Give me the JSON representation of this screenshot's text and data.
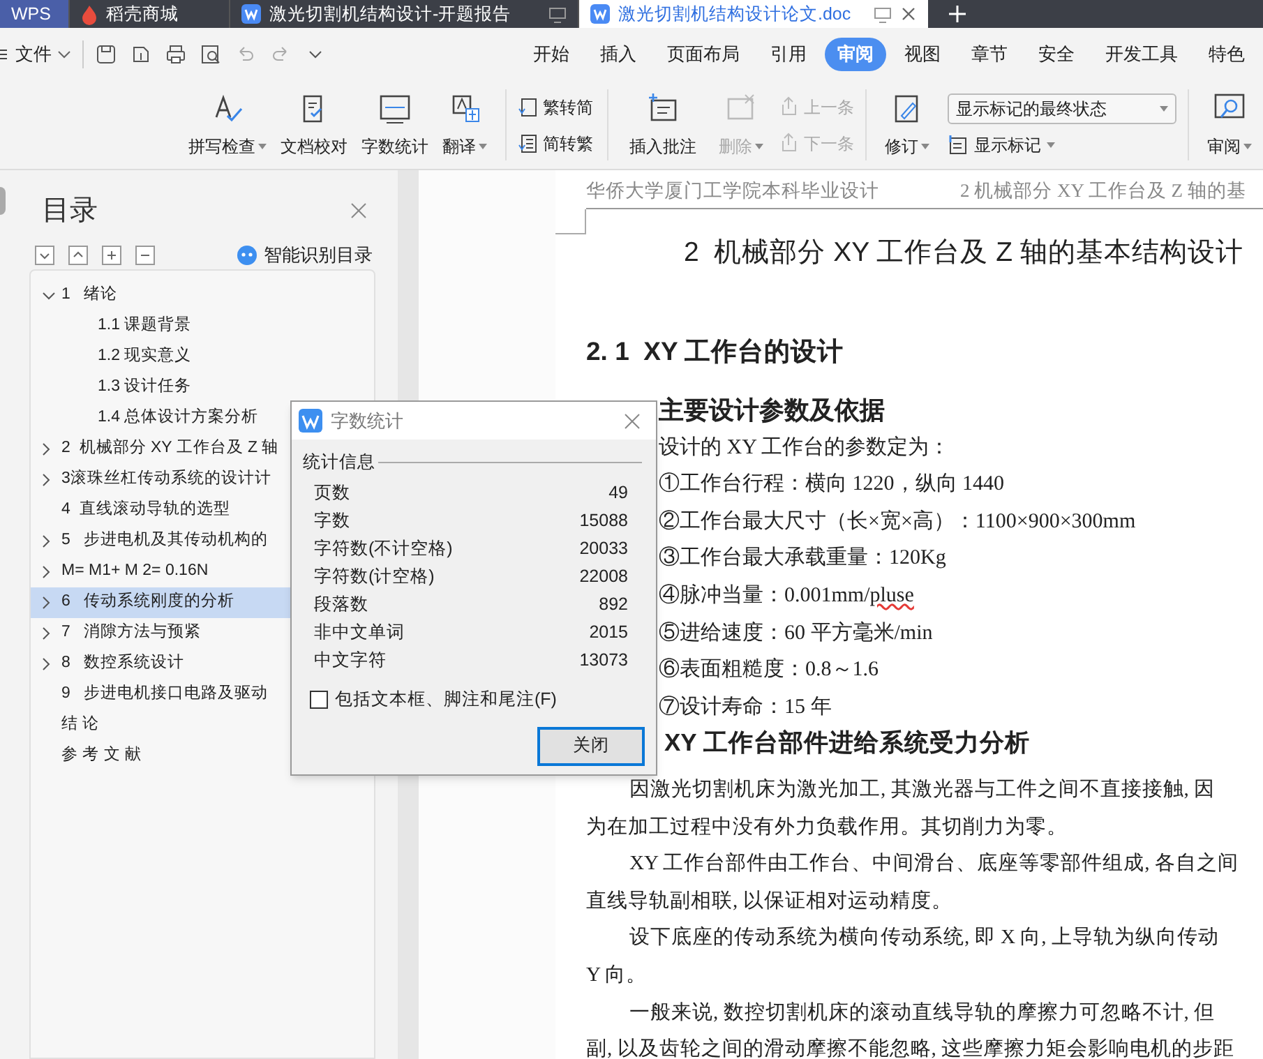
{
  "tabs": [
    {
      "label": "WPS",
      "kind": "home",
      "selected": false
    },
    {
      "label": "稻壳商城",
      "kind": "store",
      "selected": false
    },
    {
      "label": "激光切割机结构设计-开题报告",
      "kind": "doc",
      "selected": false
    },
    {
      "label": "激光切割机结构设计论文.doc",
      "kind": "doc",
      "selected": true
    }
  ],
  "menu": {
    "file": "文件",
    "ribbon_tabs": [
      {
        "label": "开始",
        "selected": false
      },
      {
        "label": "插入",
        "selected": false
      },
      {
        "label": "页面布局",
        "selected": false
      },
      {
        "label": "引用",
        "selected": false
      },
      {
        "label": "审阅",
        "selected": true
      },
      {
        "label": "视图",
        "selected": false
      },
      {
        "label": "章节",
        "selected": false
      },
      {
        "label": "安全",
        "selected": false
      },
      {
        "label": "开发工具",
        "selected": false
      },
      {
        "label": "特色",
        "selected": false
      }
    ]
  },
  "ribbon": {
    "proofing": [
      {
        "label": "拼写检查",
        "kind": "spell",
        "dropdown": true
      },
      {
        "label": "文档校对",
        "kind": "check",
        "dropdown": false
      },
      {
        "label": "字数统计",
        "kind": "count",
        "dropdown": false
      },
      {
        "label": "翻译",
        "kind": "translate",
        "dropdown": true
      }
    ],
    "convert": [
      {
        "label": "繁转简",
        "kind": "trad"
      },
      {
        "label": "简转繁",
        "kind": "simp"
      }
    ],
    "comment": {
      "label": "插入批注"
    },
    "comment_nav": [
      {
        "label": "删除",
        "dropdown": true,
        "disabled": true
      },
      {
        "label": "上一条",
        "dropdown": false,
        "disabled": true
      },
      {
        "label": "下一条",
        "dropdown": false,
        "disabled": true
      }
    ],
    "track": {
      "label": "修订"
    },
    "display_select": {
      "value": "显示标记的最终状态"
    },
    "show_markup": {
      "label": "显示标记"
    },
    "review": {
      "label": "审阅"
    }
  },
  "toc": {
    "title": "目录",
    "smart_label": "智能识别目录",
    "items": [
      {
        "label": "1   绪论",
        "expanded": true,
        "children": [
          {
            "label": "1.1 课题背景"
          },
          {
            "label": "1.2 现实意义"
          },
          {
            "label": "1.3 设计任务"
          },
          {
            "label": "1.4 总体设计方案分析"
          }
        ],
        "selected": false
      },
      {
        "label": "2  机械部分 XY 工作台及 Z 轴",
        "expanded": false,
        "has_children": true,
        "selected": false
      },
      {
        "label": "3滚珠丝杠传动系统的设计计",
        "expanded": false,
        "has_children": true,
        "selected": false
      },
      {
        "label": "4  直线滚动导轨的选型",
        "expanded": false,
        "has_children": false,
        "selected": false
      },
      {
        "label": "5   步进电机及其传动机构的",
        "expanded": false,
        "has_children": true,
        "selected": false
      },
      {
        "label": "M= M1+ M 2= 0.16N",
        "expanded": false,
        "has_children": true,
        "selected": false
      },
      {
        "label": "6   传动系统刚度的分析",
        "expanded": false,
        "has_children": true,
        "selected": true
      },
      {
        "label": "7   消隙方法与预紧",
        "expanded": false,
        "has_children": true,
        "selected": false
      },
      {
        "label": "8   数控系统设计",
        "expanded": false,
        "has_children": true,
        "selected": false
      },
      {
        "label": "9   步进电机接口电路及驱动",
        "expanded": false,
        "has_children": false,
        "selected": false
      },
      {
        "label": "结 论",
        "expanded": false,
        "has_children": false,
        "selected": false
      },
      {
        "label": "参 考 文 献",
        "expanded": false,
        "has_children": false,
        "selected": false
      }
    ]
  },
  "document": {
    "header_left": "华侨大学厦门工学院本科毕业设计",
    "header_right": "2  机械部分 XY 工作台及 Z 轴的基",
    "chapter_title": "2  机械部分 XY 工作台及 Z 轴的基本结构设计",
    "section_title": "2. 1  XY 工作台的设计",
    "subsection_1": "主要设计参数及依据",
    "params": [
      {
        "parts": [
          {
            "text": "设计的 XY 工作台的参数定为：",
            "misspelled": false
          }
        ]
      },
      {
        "parts": [
          {
            "text": "①工作台行程：横向 1220，纵向 1440",
            "misspelled": false
          }
        ]
      },
      {
        "parts": [
          {
            "text": "②工作台最大尺寸（长×宽×高）：1100×900×300mm",
            "misspelled": false
          }
        ]
      },
      {
        "parts": [
          {
            "text": "③工作台最大承载重量：120Kg",
            "misspelled": false
          }
        ]
      },
      {
        "parts": [
          {
            "text": "④脉冲当量：0.001mm/",
            "misspelled": false
          },
          {
            "text": "pluse",
            "misspelled": true
          }
        ]
      },
      {
        "parts": [
          {
            "text": "⑤进给速度：60 平方毫米/min",
            "misspelled": false
          }
        ]
      },
      {
        "parts": [
          {
            "text": "⑥表面粗糙度：0.8～1.6",
            "misspelled": false
          }
        ]
      },
      {
        "parts": [
          {
            "text": "⑦设计寿命：15 年",
            "misspelled": false
          }
        ]
      }
    ],
    "subsection_2": "XY 工作台部件进给系统受力分析",
    "paragraphs": [
      {
        "lines": [
          "因激光切割机床为激光加工, 其激光器与工件之间不直接接触, 因",
          "为在加工过程中没有外力负载作用。其切削力为零。"
        ]
      },
      {
        "lines": [
          "XY 工作台部件由工作台、中间滑台、底座等零部件组成, 各自之间",
          "直线导轨副相联, 以保证相对运动精度。"
        ]
      },
      {
        "lines": [
          "设下底座的传动系统为横向传动系统, 即 X 向, 上导轨为纵向传动",
          "Y 向。"
        ]
      },
      {
        "lines": [
          "一般来说, 数控切割机床的滚动直线导轨的摩擦力可忽略不计, 但",
          "副, 以及齿轮之间的滑动摩擦不能忽略, 这些摩擦力矩会影响电机的步距"
        ]
      }
    ]
  },
  "dialog": {
    "title": "字数统计",
    "group": "统计信息",
    "rows": [
      {
        "label": "页数",
        "value": "49"
      },
      {
        "label": "字数",
        "value": "15088"
      },
      {
        "label": "字符数(不计空格)",
        "value": "20033"
      },
      {
        "label": "字符数(计空格)",
        "value": "22008"
      },
      {
        "label": "段落数",
        "value": "892"
      },
      {
        "label": "非中文单词",
        "value": "2015"
      },
      {
        "label": "中文字符",
        "value": "13073"
      }
    ],
    "checkbox": {
      "label": "包括文本框、脚注和尾注(F)",
      "checked": false
    },
    "button": {
      "label": "关闭",
      "focused": true
    }
  }
}
